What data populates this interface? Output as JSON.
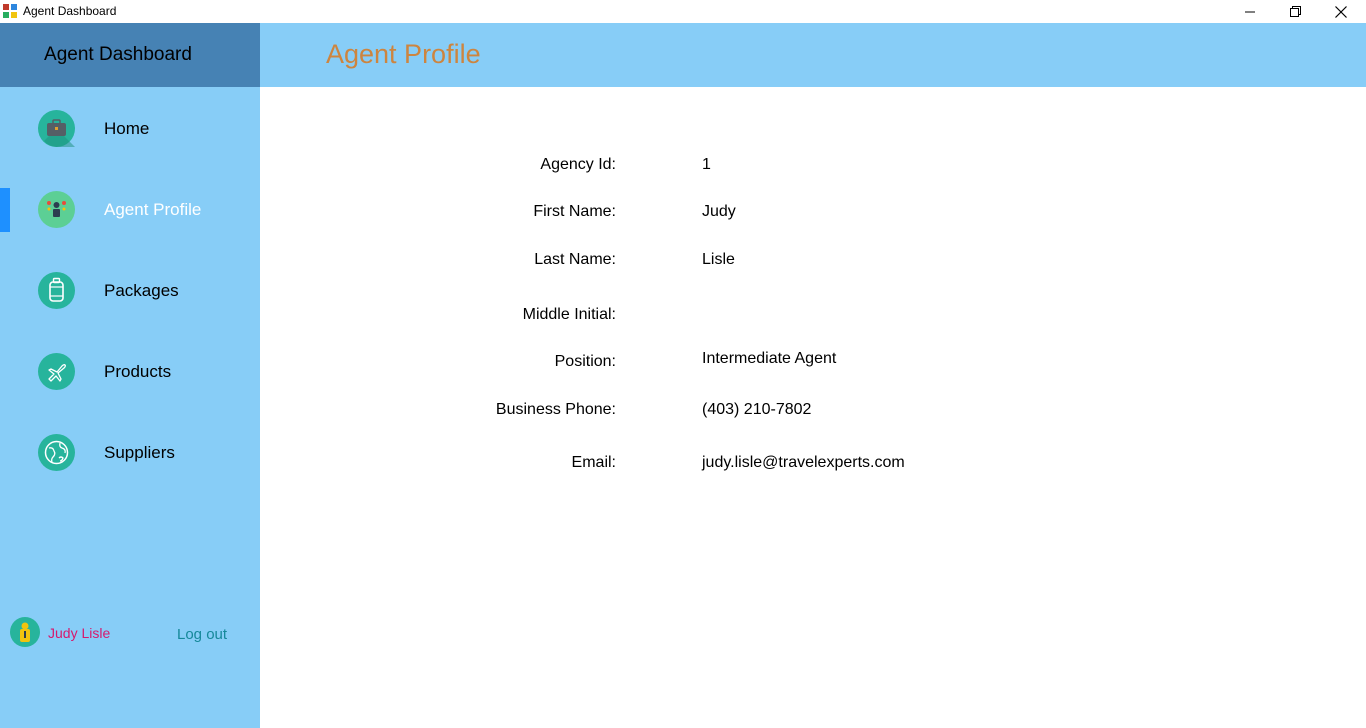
{
  "window": {
    "title": "Agent Dashboard"
  },
  "sidebar": {
    "title": "Agent Dashboard",
    "items": [
      {
        "label": "Home",
        "icon": "briefcase-icon"
      },
      {
        "label": "Agent Profile",
        "icon": "agent-icon",
        "active": true
      },
      {
        "label": "Packages",
        "icon": "suitcase-icon"
      },
      {
        "label": "Products",
        "icon": "airplane-icon"
      },
      {
        "label": "Suppliers",
        "icon": "globe-icon"
      }
    ],
    "user_name": "Judy Lisle",
    "logout_label": "Log out"
  },
  "header": {
    "title": "Agent Profile"
  },
  "profile": {
    "fields": [
      {
        "label": "Agency Id:",
        "value": "1"
      },
      {
        "label": "First Name:",
        "value": "Judy"
      },
      {
        "label": "Last Name:",
        "value": "Lisle"
      },
      {
        "label": "Middle Initial:",
        "value": ""
      },
      {
        "label": "Position:",
        "value": "Intermediate Agent"
      },
      {
        "label": "Business Phone:",
        "value": "(403) 210-7802"
      },
      {
        "label": "Email:",
        "value": "judy.lisle@travelexperts.com"
      }
    ]
  },
  "colors": {
    "sidebar_bg": "#87cdf7",
    "sidebar_header_bg": "#4682b4",
    "active_indicator": "#1e90ff",
    "title_accent": "#cd853f",
    "user_name": "#d61a6e",
    "logout": "#15889a",
    "icon_circle": "#27b49c"
  }
}
